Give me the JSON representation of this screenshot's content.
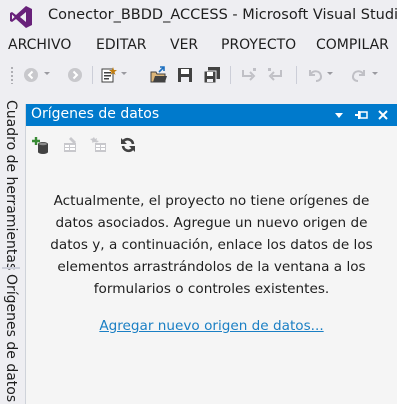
{
  "window": {
    "title": "Conector_BBDD_ACCESS - Microsoft Visual Studio",
    "logo_icon": "visual-studio-logo",
    "accent": "#68217a"
  },
  "menu": {
    "items": [
      "ARCHIVO",
      "EDITAR",
      "VER",
      "PROYECTO",
      "COMPILAR"
    ]
  },
  "toolbar": {
    "buttons": [
      "back-icon",
      "forward-icon",
      "new-project-icon",
      "open-file-icon",
      "save-icon",
      "save-all-icon",
      "step-into-icon",
      "step-out-icon",
      "undo-icon",
      "redo-icon"
    ]
  },
  "side_tabs": {
    "items": [
      "Cuadro de herramientas",
      "Orígenes de datos"
    ]
  },
  "panel": {
    "title": "Orígenes de datos",
    "header_color": "#007acc",
    "message": "Actualmente, el proyecto no tiene orígenes de datos asociados. Agregue un nuevo origen de datos y, a continuación, enlace los datos de los elementos arrastrándolos de la ventana a los formularios o controles existentes.",
    "link": "Agregar nuevo origen de datos...",
    "link_color": "#1a7fc4",
    "toolbar_icons": [
      "add-data-source-icon",
      "edit-dataset-icon",
      "configure-dataset-icon",
      "refresh-icon"
    ]
  }
}
